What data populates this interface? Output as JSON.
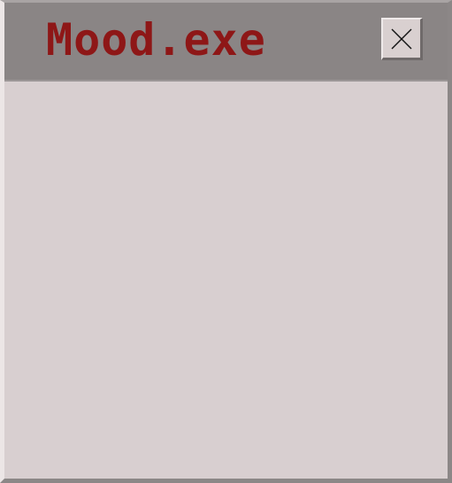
{
  "window": {
    "title": "Mood.exe",
    "close_icon": "close-icon"
  },
  "colors": {
    "title_text": "#8e1717",
    "titlebar": "#8a8585",
    "window_body": "#d8cfd0"
  }
}
